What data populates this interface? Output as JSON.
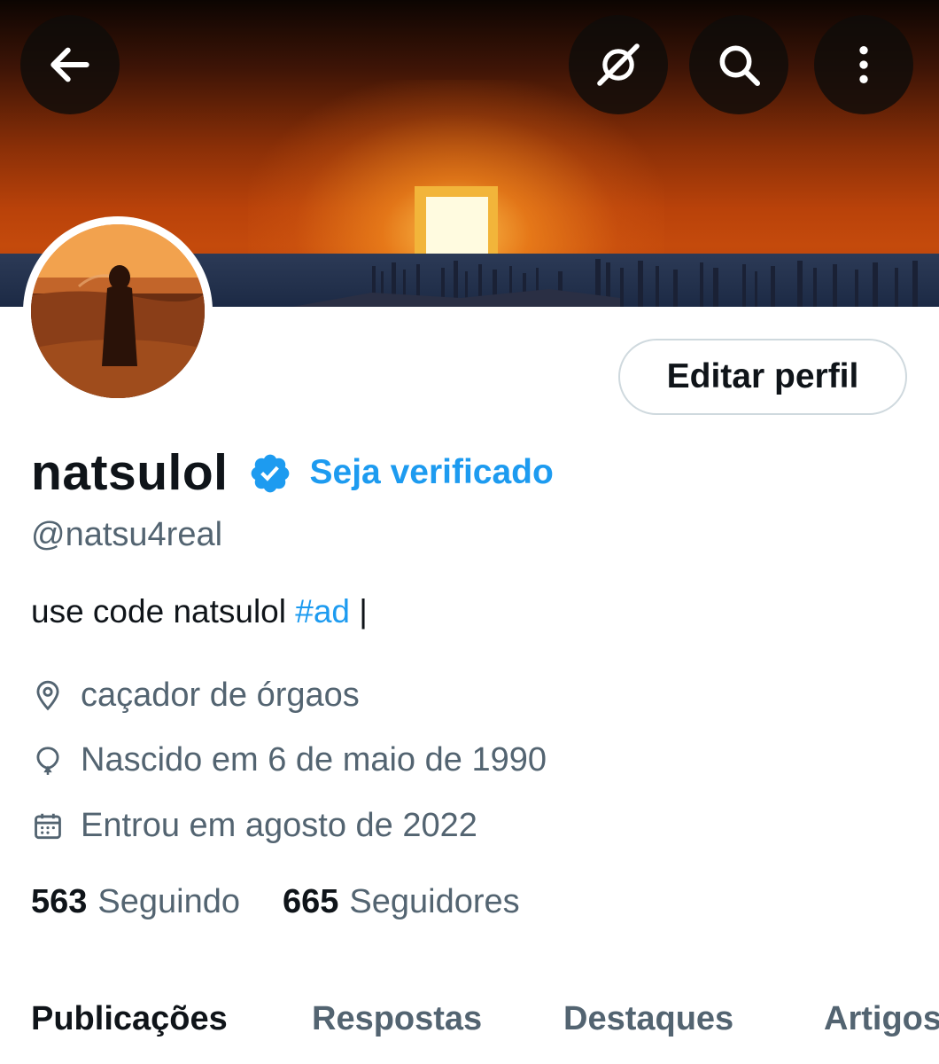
{
  "header": {
    "back_icon": "arrow-left-icon",
    "grok_icon": "grok-icon",
    "search_icon": "search-icon",
    "more_icon": "more-vertical-icon"
  },
  "profile": {
    "name": "natsulol",
    "verified_icon": "verified-badge-icon",
    "get_verified_label": "Seja verificado",
    "handle": "@natsu4real",
    "bio_text": "use code natsulol ",
    "bio_hashtag": "#ad",
    "bio_suffix": " |",
    "edit_button_label": "Editar perfil",
    "location": "caçador de órgaos",
    "birthday": "Nascido em 6 de maio de 1990",
    "joined": "Entrou em agosto de 2022"
  },
  "stats": {
    "following_count": "563",
    "following_label": "Seguindo",
    "followers_count": "665",
    "followers_label": "Seguidores"
  },
  "tabs": [
    {
      "label": "Publicações",
      "active": true
    },
    {
      "label": "Respostas",
      "active": false
    },
    {
      "label": "Destaques",
      "active": false
    },
    {
      "label": "Artigos",
      "active": false
    }
  ],
  "colors": {
    "accent": "#1d9bf0",
    "text_primary": "#0f1419",
    "text_secondary": "#536471"
  }
}
